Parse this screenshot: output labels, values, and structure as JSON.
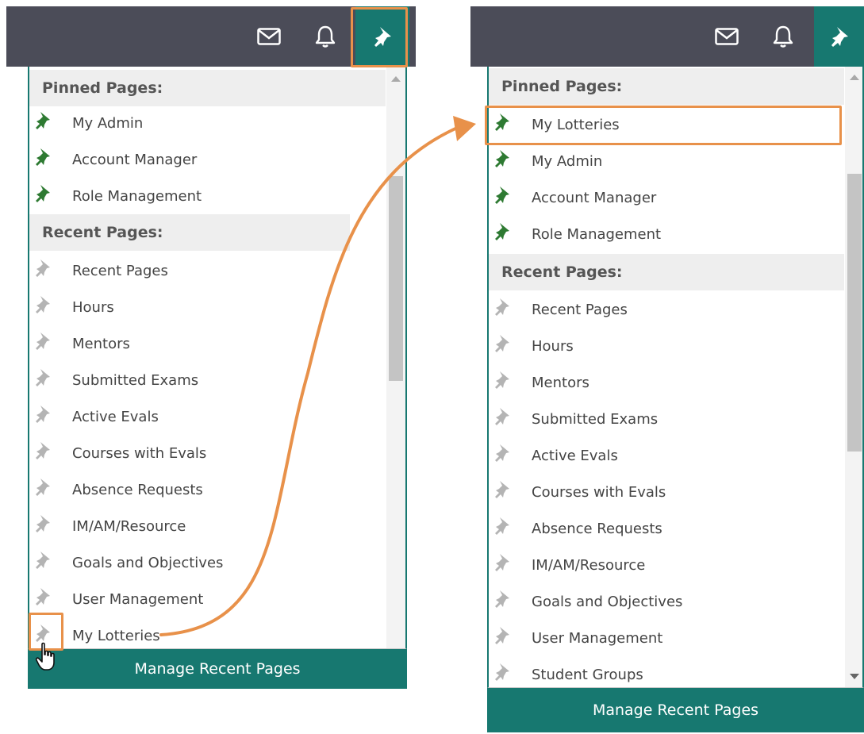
{
  "colors": {
    "topbar": "#4b4c58",
    "accent": "#177870",
    "highlight": "#e8914a",
    "pin_active": "#2e7a32",
    "pin_inactive": "#b4b4b4"
  },
  "before": {
    "topbar": {
      "icons": [
        "mail-icon",
        "bell-icon",
        "pin-icon"
      ]
    },
    "pinned_header": "Pinned Pages:",
    "pinned": [
      "My Admin",
      "Account Manager",
      "Role Management"
    ],
    "recent_header": "Recent Pages:",
    "recent": [
      "Recent Pages",
      "Hours",
      "Mentors",
      "Submitted Exams",
      "Active Evals",
      "Courses with Evals",
      "Absence Requests",
      "IM/AM/Resource",
      "Goals and Objectives",
      "User Management",
      "My Lotteries"
    ],
    "footer": "Manage Recent Pages"
  },
  "after": {
    "topbar": {
      "icons": [
        "mail-icon",
        "bell-icon",
        "pin-icon"
      ]
    },
    "pinned_header": "Pinned Pages:",
    "pinned": [
      "My Lotteries",
      "My Admin",
      "Account Manager",
      "Role Management"
    ],
    "recent_header": "Recent Pages:",
    "recent": [
      "Recent Pages",
      "Hours",
      "Mentors",
      "Submitted Exams",
      "Active Evals",
      "Courses with Evals",
      "Absence Requests",
      "IM/AM/Resource",
      "Goals and Objectives",
      "User Management",
      "Student Groups"
    ],
    "footer": "Manage Recent Pages"
  }
}
